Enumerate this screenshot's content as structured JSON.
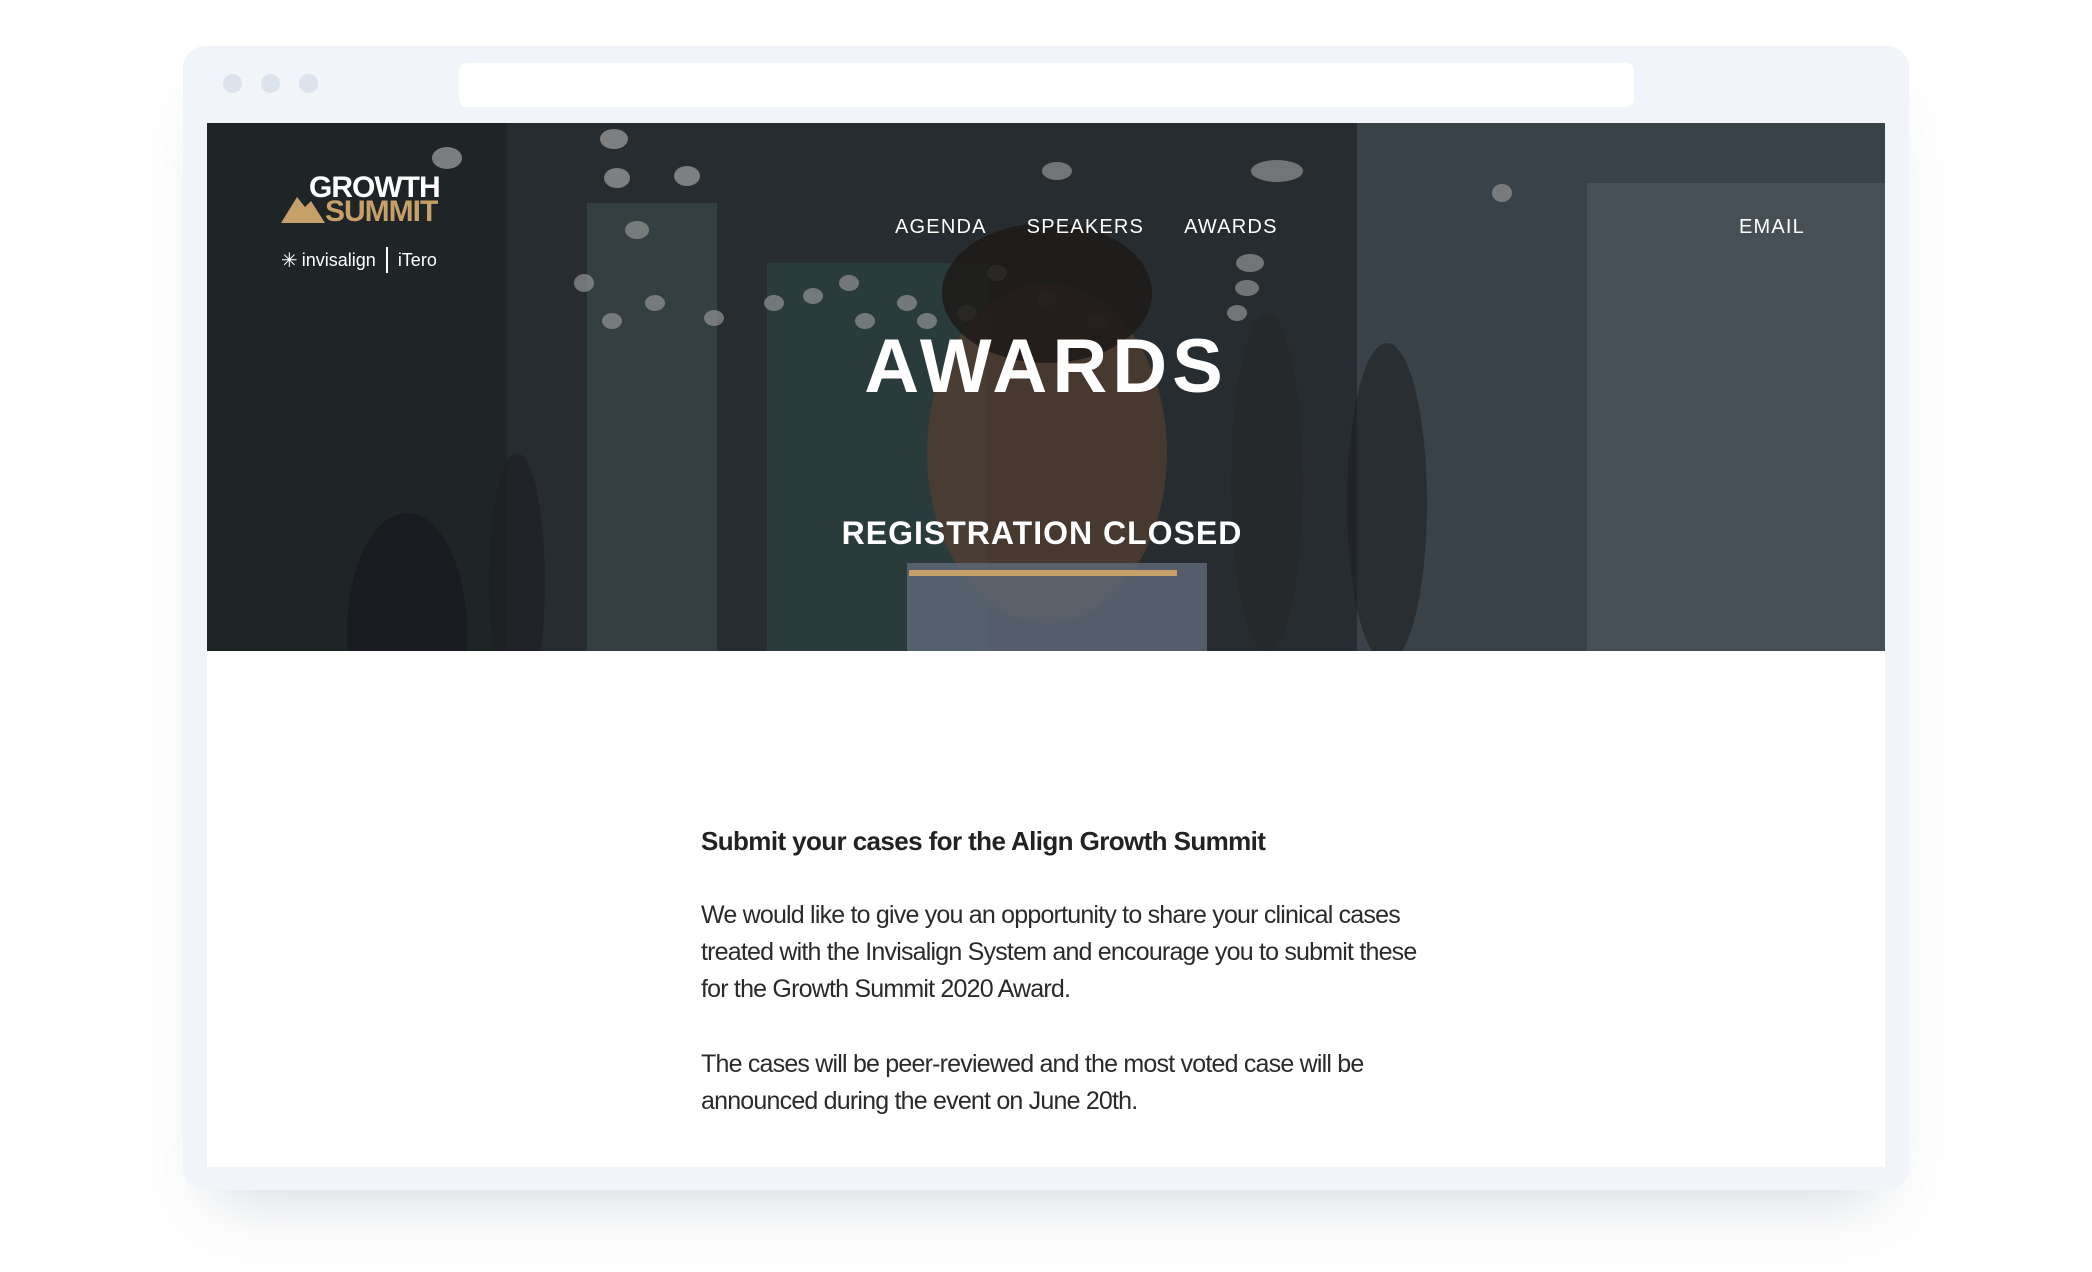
{
  "browser": {
    "url": ""
  },
  "header": {
    "logo": {
      "line1": "GROWTH",
      "line2": "SUMMIT"
    },
    "brands": {
      "invisalign": "invisalign",
      "itero": "iTero"
    },
    "nav": [
      {
        "label": "AGENDA"
      },
      {
        "label": "SPEAKERS"
      },
      {
        "label": "AWARDS"
      }
    ],
    "email_label": "EMAIL"
  },
  "hero": {
    "title": "AWARDS",
    "registration_status": "REGISTRATION CLOSED"
  },
  "main": {
    "heading": "Submit your cases for the Align Growth Summit",
    "paragraphs": [
      "We would like to give you an opportunity to share your clinical cases treated with the Invisalign System and encourage you to submit these for the Growth Summit 2020 Award.",
      "The cases will be peer-reviewed and the most voted case will be announced during the event on June 20th."
    ]
  },
  "colors": {
    "accent": "#c5a069",
    "frame": "#f1f5f9",
    "text": "#222222"
  }
}
